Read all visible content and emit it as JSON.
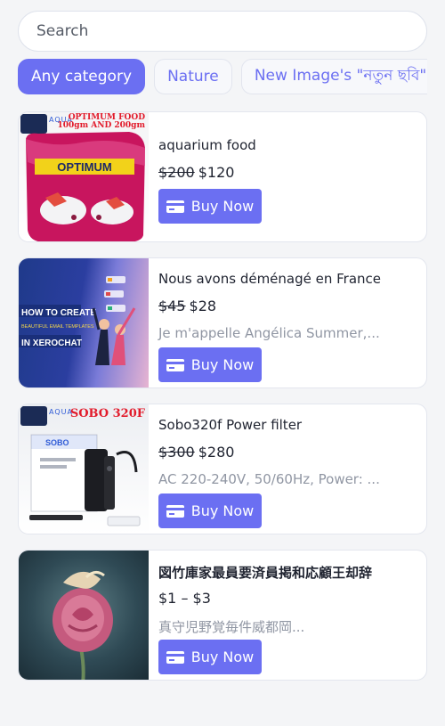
{
  "search": {
    "placeholder": "Search"
  },
  "categories": [
    "Any category",
    "Nature",
    "New Image's \"নতুন ছবি\""
  ],
  "buy_label": "Buy Now",
  "products": [
    {
      "title": "aquarium food",
      "old_price": "$200",
      "price": "$120",
      "image_text": {
        "brand": "AQUA",
        "headline": "OPTIMUM FOOD",
        "sub": "100gm AND 200gm",
        "label": "OPTIMUM"
      }
    },
    {
      "title": "Nous avons déménagé en France",
      "old_price": "$45",
      "price": "$28",
      "description": "Je m'appelle Angélica Summer,...",
      "image_text": {
        "line1": "HOW TO CREATE",
        "line2": "BEAUTIFUL EMAIL TEMPLATES",
        "line3": "IN XEROCHAT"
      }
    },
    {
      "title": "Sobo320f Power filter",
      "old_price": "$300",
      "price": "$280",
      "description": "AC 220-240V, 50/60Hz, Power: ...",
      "image_text": {
        "brand": "AQUA",
        "headline": "SOBO 320F",
        "box_brand": "SOBO"
      }
    },
    {
      "title": "図竹庫家最員要済員掲和応顧王却辞",
      "price_range": "$1 – $3",
      "description": "真守児野覚毎件威都岡..."
    }
  ]
}
